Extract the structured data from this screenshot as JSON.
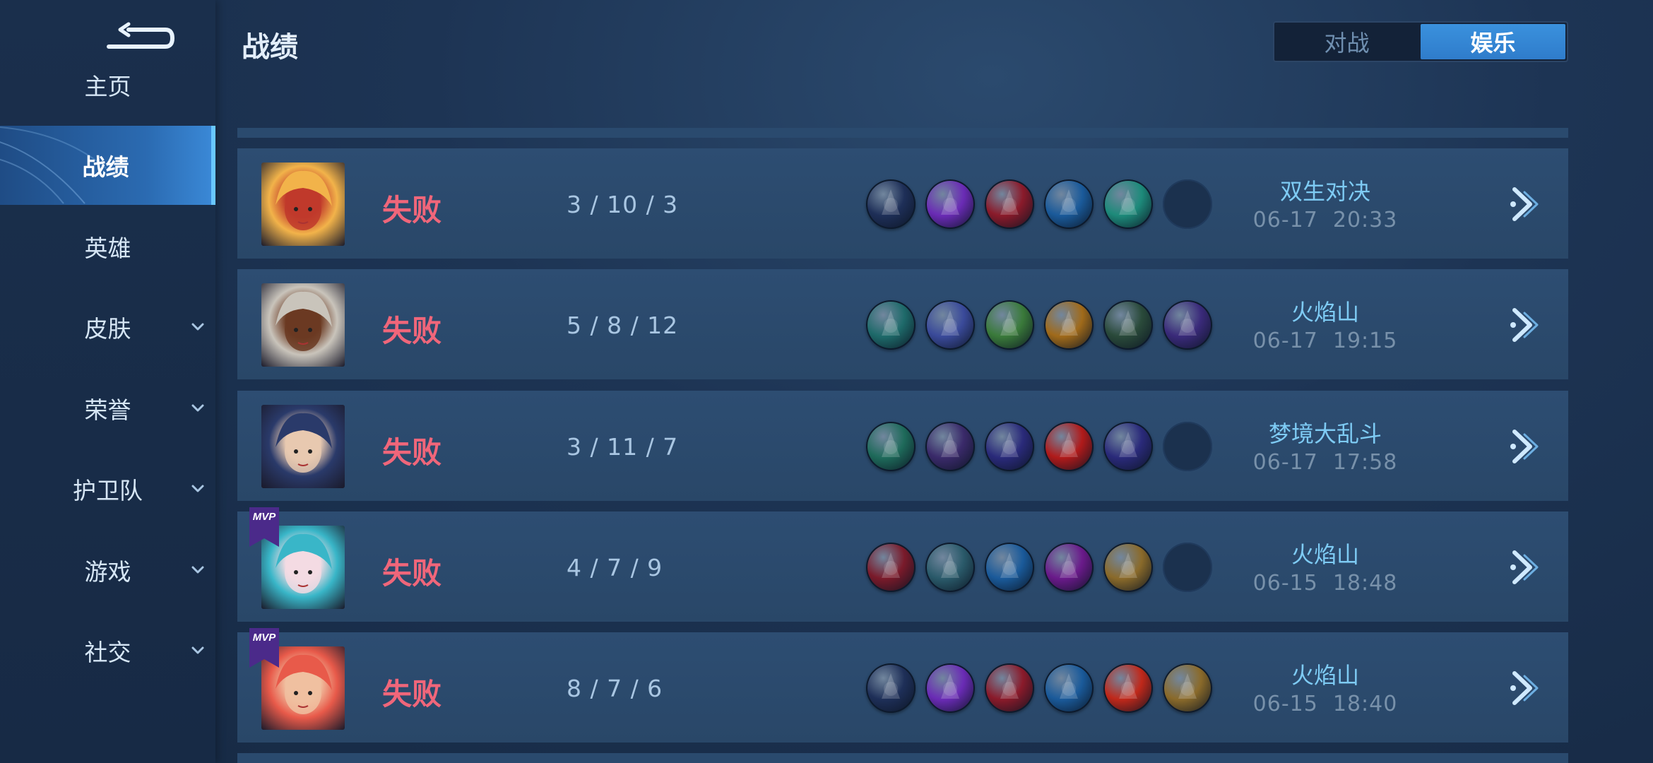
{
  "header": {
    "title": "战绩"
  },
  "tabs": [
    {
      "label": "对战",
      "active": false
    },
    {
      "label": "娱乐",
      "active": true
    }
  ],
  "sidebar": {
    "items": [
      {
        "label": "主页",
        "active": false,
        "has_chevron": false
      },
      {
        "label": "战绩",
        "active": true,
        "has_chevron": false
      },
      {
        "label": "英雄",
        "active": false,
        "has_chevron": false
      },
      {
        "label": "皮肤",
        "active": false,
        "has_chevron": true
      },
      {
        "label": "荣誉",
        "active": false,
        "has_chevron": true
      },
      {
        "label": "护卫队",
        "active": false,
        "has_chevron": true
      },
      {
        "label": "游戏",
        "active": false,
        "has_chevron": true
      },
      {
        "label": "社交",
        "active": false,
        "has_chevron": true
      }
    ]
  },
  "matches": [
    {
      "result": "失败",
      "kda": "3 / 10 / 3",
      "mode": "双生对决",
      "time": "06-17  20:33",
      "mvp": false,
      "hero_colors": [
        "#f2b34a",
        "#c0392b"
      ],
      "items": [
        "#1e2f58",
        "#6a2bb5",
        "#8a1a2a",
        "#1a5a9a",
        "#1d8a7a",
        "empty"
      ]
    },
    {
      "result": "失败",
      "kda": "5 / 8 / 12",
      "mode": "火焰山",
      "time": "06-17  19:15",
      "mvp": false,
      "hero_colors": [
        "#c9c4bb",
        "#6b3a22"
      ],
      "items": [
        "#1e6a6a",
        "#3a4a9a",
        "#3a7a3a",
        "#a06a1a",
        "#2a4a3a",
        "#3a2a7a"
      ]
    },
    {
      "result": "失败",
      "kda": "3 / 11 / 7",
      "mode": "梦境大乱斗",
      "time": "06-17  17:58",
      "mvp": false,
      "hero_colors": [
        "#2a3a6a",
        "#e8c9b0"
      ],
      "items": [
        "#1e6a5a",
        "#3a2a6a",
        "#2a2a7a",
        "#b01a1a",
        "#2a2a7a",
        "empty"
      ]
    },
    {
      "result": "失败",
      "kda": "4 / 7 / 9",
      "mode": "火焰山",
      "time": "06-15  18:48",
      "mvp": true,
      "hero_colors": [
        "#39b6c8",
        "#f3dbe3"
      ],
      "items": [
        "#7a1a2a",
        "#2a5a6a",
        "#1a5a9a",
        "#6a1a8a",
        "#8a6a2a",
        "empty"
      ]
    },
    {
      "result": "失败",
      "kda": "8 / 7 / 6",
      "mode": "火焰山",
      "time": "06-15  18:40",
      "mvp": true,
      "hero_colors": [
        "#e85a4a",
        "#f0c0a0"
      ],
      "items": [
        "#1e2f58",
        "#6a2bb5",
        "#8a1a2a",
        "#1a5a9a",
        "#c0281a",
        "#8a6a2a"
      ]
    }
  ],
  "mvp_label": "MVP",
  "colors": {
    "accent": "#2f7ccb",
    "loss": "#f0667a",
    "mode": "#7ecbf4"
  }
}
